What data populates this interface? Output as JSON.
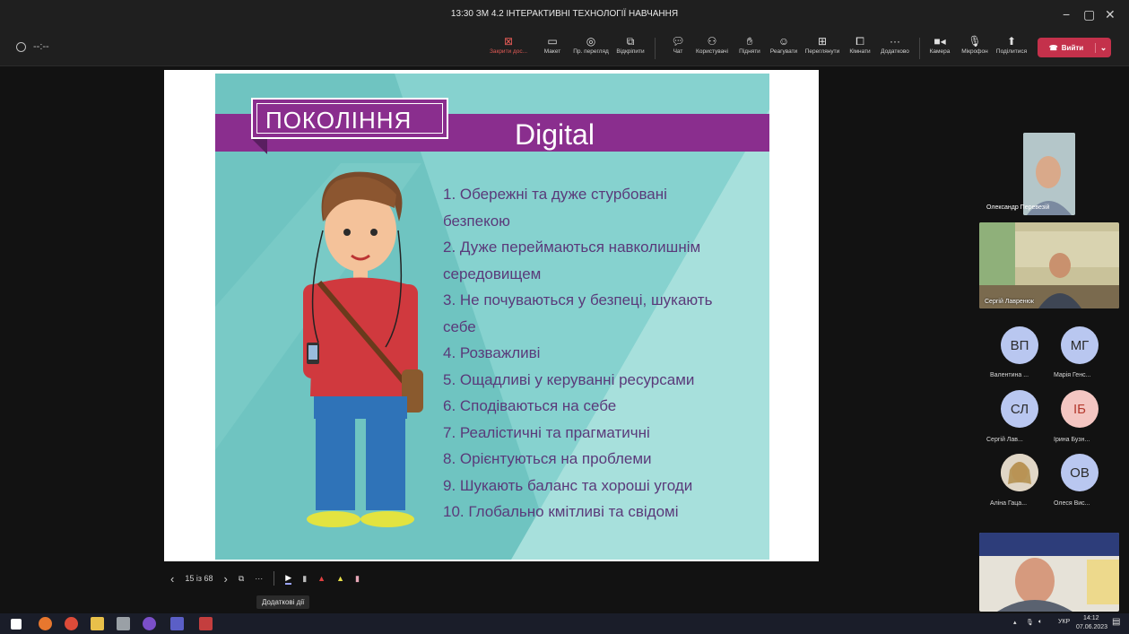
{
  "window": {
    "title": "13:30 ЗМ 4.2 ІНТЕРАКТИВНІ ТЕХНОЛОГІЇ НАВЧАННЯ"
  },
  "meeting": {
    "timer": "--:--"
  },
  "toolbar": {
    "stop_share": "Закрити дос...",
    "layout": "Макет",
    "preview": "Пр. перегляд",
    "pop_out": "Відкріпити",
    "chat": "Чат",
    "people": "Користувачі",
    "raise": "Підняти",
    "react": "Реагувати",
    "view": "Переглянути",
    "rooms": "Кімнати",
    "more": "Додатково",
    "camera": "Камера",
    "mic": "Мікрофон",
    "share": "Поділитися",
    "leave": "Вийти"
  },
  "slide": {
    "title_left": "ПОКОЛІННЯ",
    "title_right": "Digital",
    "items": [
      "1. Обережні та дуже стурбовані",
      "безпекою",
      "2. Дуже переймаються навколишнім",
      "середовищем",
      "3. Не почуваються у безпеці, шукають",
      "себе",
      "4. Розважливі",
      "5. Ощадливі у керуванні ресурсами",
      "6. Сподіваються на себе",
      "7. Реалістичні та прагматичні",
      "8. Орієнтуються на проблеми",
      "9. Шукають баланс та хороші угоди",
      "10. Глобально кмітливі та свідомі"
    ]
  },
  "slide_controls": {
    "counter": "15 із 68",
    "tooltip": "Додаткові дії"
  },
  "participants": {
    "video1": "Олександр Перевезій",
    "video2": "Сергій Лавренюк",
    "avatars": [
      {
        "initials": "ВП",
        "name": "Валентина ...",
        "color": "#b9c7f0"
      },
      {
        "initials": "МГ",
        "name": "Марія Генс...",
        "color": "#b9c7f0"
      },
      {
        "initials": "СЛ",
        "name": "Сергій Лав...",
        "color": "#b9c7f0"
      },
      {
        "initials": "ІБ",
        "name": "Ірина Бузн...",
        "color": "#f4c6c2"
      },
      {
        "initials": "",
        "name": "Аліна Гаца...",
        "color": "#c9a98a"
      },
      {
        "initials": "ОВ",
        "name": "Олеся Вис...",
        "color": "#b9c7f0"
      }
    ]
  },
  "taskbar": {
    "lang": "УКР",
    "time": "14:12",
    "date": "07.06.2023"
  }
}
